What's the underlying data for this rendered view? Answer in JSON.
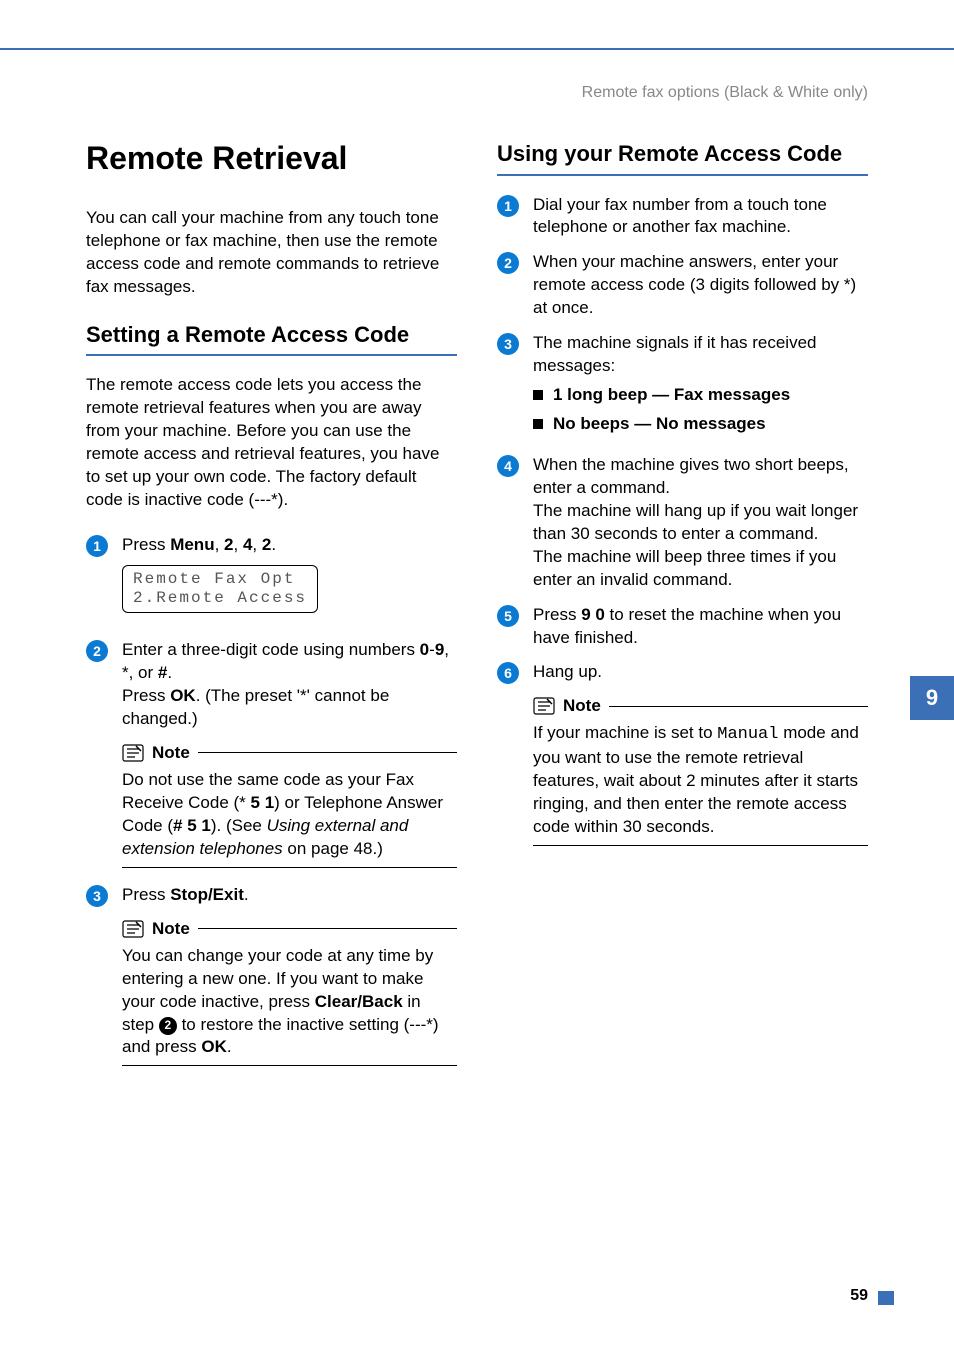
{
  "header": "Remote fax options (Black & White only)",
  "chapter_tab": "9",
  "page_number": "59",
  "left": {
    "h1": "Remote Retrieval",
    "intro": "You can call your machine from any touch tone telephone or fax machine, then use the remote access code and remote commands to retrieve fax messages.",
    "h2": "Setting a Remote Access Code",
    "para": "The remote access code lets you access the remote retrieval features when you are away from your machine. Before you can use the remote access and retrieval features, you have to set up your own code. The factory default code is inactive code (---*).",
    "step1_a": "Press ",
    "step1_menu": "Menu",
    "step1_b": ", ",
    "step1_k1": "2",
    "step1_c": ", ",
    "step1_k2": "4",
    "step1_d": ", ",
    "step1_k3": "2",
    "step1_e": ".",
    "lcd_line1": "Remote Fax Opt",
    "lcd_line2": "2.Remote Access",
    "step2_a": "Enter a three-digit code using numbers ",
    "step2_09": "0",
    "step2_dash": "-",
    "step2_9": "9",
    "step2_c1": ", *, or ",
    "step2_hash": "#",
    "step2_c2": ".",
    "step2_line2a": "Press ",
    "step2_ok": "OK",
    "step2_line2b": ". (The preset '*' cannot be changed.)",
    "note1_label": "Note",
    "note1_a": "Do not use the same code as your Fax Receive Code (* ",
    "note1_51": "5 1",
    "note1_b": ") or Telephone Answer Code (",
    "note1_hash51": "# 5 1",
    "note1_c": "). (See ",
    "note1_ref": "Using external and extension telephones",
    "note1_d": " on page 48.)",
    "step3_a": "Press ",
    "step3_stop": "Stop/Exit",
    "step3_b": ".",
    "note2_label": "Note",
    "note2_a": "You can change your code at any time by entering a new one. If you want to make your code inactive, press ",
    "note2_clear": "Clear/Back",
    "note2_b": " in step ",
    "note2_refnum": "2",
    "note2_c": " to restore the inactive setting (---*) and press ",
    "note2_ok": "OK",
    "note2_d": "."
  },
  "right": {
    "h2": "Using your Remote Access Code",
    "s1": "Dial your fax number from a touch tone telephone or another fax machine.",
    "s2": "When your machine answers, enter your remote access code (3 digits followed by *) at once.",
    "s3": "The machine signals if it has received messages:",
    "s3_b1": "1 long beep — Fax messages",
    "s3_b2": "No beeps — No messages",
    "s4a": "When the machine gives two short beeps, enter a command.",
    "s4b": "The machine will hang up if you wait longer than 30 seconds to enter a command.",
    "s4c": "The machine will beep three times if you enter an invalid command.",
    "s5a": "Press ",
    "s5_90": "9 0",
    "s5b": " to reset the machine when you have finished.",
    "s6": "Hang up.",
    "note_label": "Note",
    "note_a": "If your machine is set to ",
    "note_manual": "Manual",
    "note_b": " mode and you want to use the remote retrieval features, wait about 2 minutes after it starts ringing, and then enter the remote access code within 30 seconds."
  }
}
